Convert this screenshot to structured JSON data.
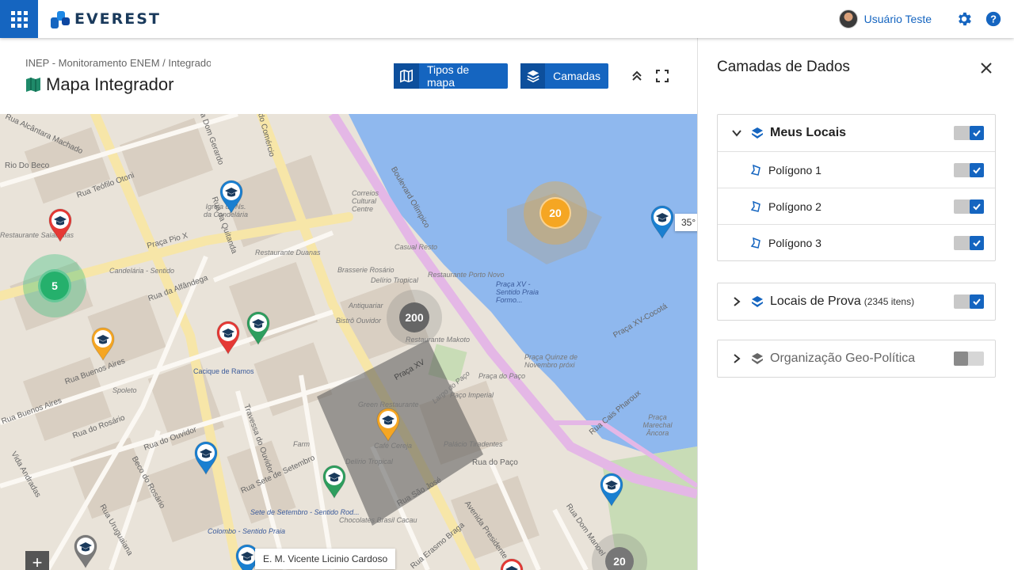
{
  "app": {
    "brand": "EVEREST",
    "brand_color": "#1565c0"
  },
  "user": {
    "name": "Usuário Teste"
  },
  "header": {
    "breadcrumb": "INEP - Monitoramento ENEM / Integrador",
    "title": "Mapa Integrador",
    "map_types_label": "Tipos de mapa",
    "layers_label": "Camadas"
  },
  "map": {
    "clusters": [
      {
        "count": "5",
        "color": "green"
      },
      {
        "count": "20",
        "color": "orange"
      },
      {
        "count": "200",
        "color": "gray"
      },
      {
        "count": "20",
        "color": "gray"
      }
    ],
    "tooltip_school": "E. M. Vicente Licinio Cardoso",
    "tooltip_partial": "35°",
    "zoom_in": "+",
    "street_labels": [
      "Rua Alcântara Machado",
      "Rio Do Beco",
      "Rua Teófilo Otoni",
      "Praça Pio X",
      "Igreja de Ns. da Candelária",
      "Rua da Quitanda",
      "Rua da Alfândega",
      "Candelária - Sentido",
      "Rua Buenos Aires",
      "Cacique de Ramos",
      "Spoleto",
      "Rua do Rosário",
      "Rua do Ouvidor",
      "Beco do Rosário",
      "Travessa do Ouvidor",
      "Rua Sete de Setembro",
      "Rua Uruguaiana",
      "Restaurante Duanas",
      "Brasserie Rosário",
      "Delírio Tropical",
      "Antiquariar",
      "Bistrô Ouvidor",
      "Restaurante Makoto",
      "Praça XV",
      "Green Restaurante",
      "Largo do Paço",
      "Paço Imperial",
      "Café Cereja",
      "Palácio Tiradentes",
      "Rua do Paço",
      "Rua São José",
      "Delírio Tropical",
      "Chocolates Brasil Cacau",
      "Colombo - Sentido Praia",
      "Sete de Setembro - Sentido Rod...",
      "Avenida Presidente",
      "Rua Dom Manoel",
      "Casual Resto",
      "Restaurante Porto Novo",
      "Praça XV - Sentido Praia Formo...",
      "Praça Quinze de Novembro próxi",
      "Boulevard Olímpico",
      "Praça Marechal Âncora",
      "Rua Cais Pharoux",
      "Praça XV-Cocotá",
      "Correios Cultural Centre",
      "Farm",
      "Restaurante Saladellas",
      "Travessa do Comércio",
      "Rua Buenos Aires",
      "Praça do Paço",
      "Rua Erasmo Braga",
      "Rua Dom Gerardo",
      "Vida Andradas"
    ]
  },
  "panel": {
    "title": "Camadas de Dados",
    "groups": [
      {
        "name": "Meus Locais",
        "enabled": true,
        "expanded": true,
        "children": [
          {
            "name": "Polígono 1",
            "enabled": true
          },
          {
            "name": "Polígono 2",
            "enabled": true
          },
          {
            "name": "Polígono 3",
            "enabled": true
          }
        ]
      },
      {
        "name": "Locais de Prova",
        "count": "(2345 itens)",
        "enabled": true,
        "expanded": false
      },
      {
        "name": "Organização Geo-Política",
        "enabled": false,
        "expanded": false
      }
    ]
  },
  "colors": {
    "primary": "#1565c0",
    "pin_blue": "#1a7fd0",
    "pin_red": "#e53935",
    "pin_green": "#2e9e5e",
    "pin_yellow": "#f5a623",
    "pin_gray": "#7a7a7a",
    "water": "#8fb8ee"
  }
}
